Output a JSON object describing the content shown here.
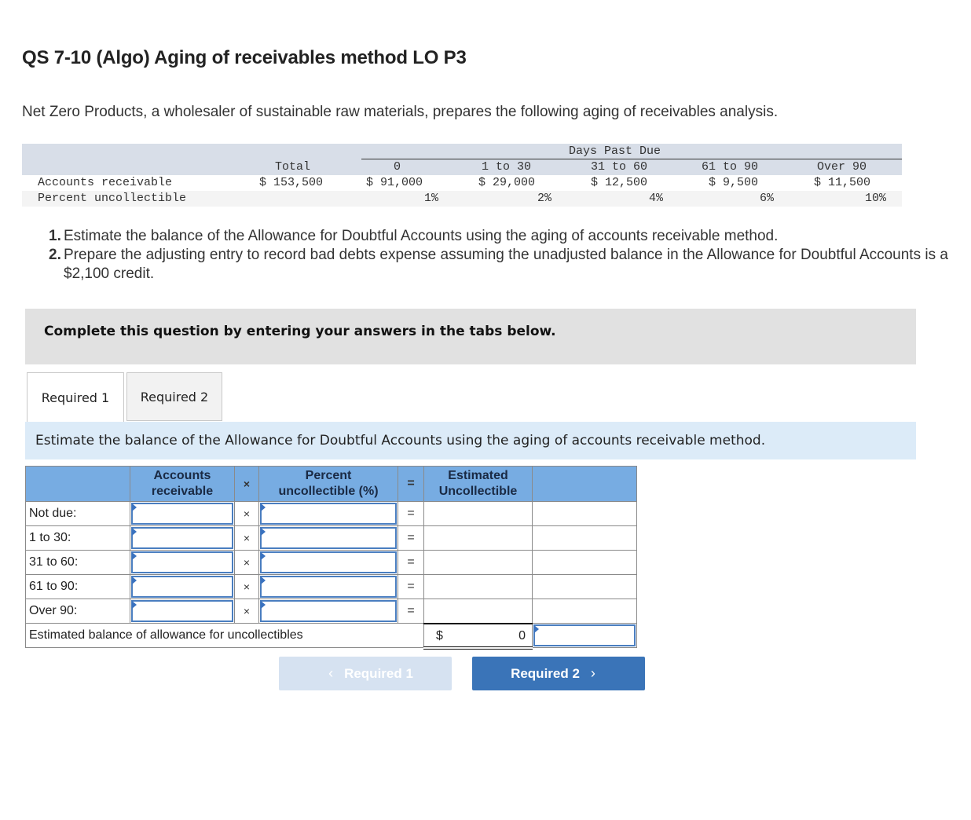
{
  "header": {
    "title": "QS 7-10 (Algo) Aging of receivables method LO P3",
    "intro": "Net Zero Products, a wholesaler of sustainable raw materials, prepares the following aging of receivables analysis."
  },
  "aging_table": {
    "group_header": "Days Past Due",
    "columns": [
      "Total",
      "0",
      "1 to 30",
      "31 to 60",
      "61 to 90",
      "Over 90"
    ],
    "rows": [
      {
        "label": "Accounts receivable",
        "values": [
          "$ 153,500",
          "$ 91,000",
          "$ 29,000",
          "$ 12,500",
          "$ 9,500",
          "$ 11,500"
        ]
      },
      {
        "label": "Percent uncollectible",
        "values": [
          "",
          "1%",
          "2%",
          "4%",
          "6%",
          "10%"
        ]
      }
    ]
  },
  "tasks": [
    {
      "num": "1.",
      "text": "Estimate the balance of the Allowance for Doubtful Accounts using the aging of accounts receivable method."
    },
    {
      "num": "2.",
      "text": "Prepare the adjusting entry to record bad debts expense assuming the unadjusted balance in the Allowance for Doubtful Accounts is a $2,100 credit."
    }
  ],
  "instruction": "Complete this question by entering your answers in the tabs below.",
  "tabs": [
    {
      "label": "Required 1",
      "active": true
    },
    {
      "label": "Required 2",
      "active": false
    }
  ],
  "prompt": "Estimate the balance of the Allowance for Doubtful Accounts using the aging of accounts receivable method.",
  "answer_table": {
    "headers": {
      "accounts_receivable": "Accounts receivable",
      "times": "×",
      "percent": "Percent uncollectible (%)",
      "equals": "=",
      "estimated": "Estimated Uncollectible"
    },
    "rows": [
      {
        "label": "Not due:",
        "times": "×",
        "equals": "=",
        "ar_value": "",
        "pct_value": ""
      },
      {
        "label": "1 to 30:",
        "times": "×",
        "equals": "=",
        "ar_value": "",
        "pct_value": ""
      },
      {
        "label": "31 to 60:",
        "times": "×",
        "equals": "=",
        "ar_value": "",
        "pct_value": ""
      },
      {
        "label": "61 to 90:",
        "times": "×",
        "equals": "=",
        "ar_value": "",
        "pct_value": ""
      },
      {
        "label": "Over 90:",
        "times": "×",
        "equals": "=",
        "ar_value": "",
        "pct_value": ""
      }
    ],
    "total": {
      "label": "Estimated balance of allowance for uncollectibles",
      "currency": "$",
      "amount": "0",
      "input_value": ""
    }
  },
  "navigation": {
    "prev_label": "Required 1",
    "next_label": "Required 2",
    "prev_icon": "‹",
    "next_icon": "›"
  }
}
